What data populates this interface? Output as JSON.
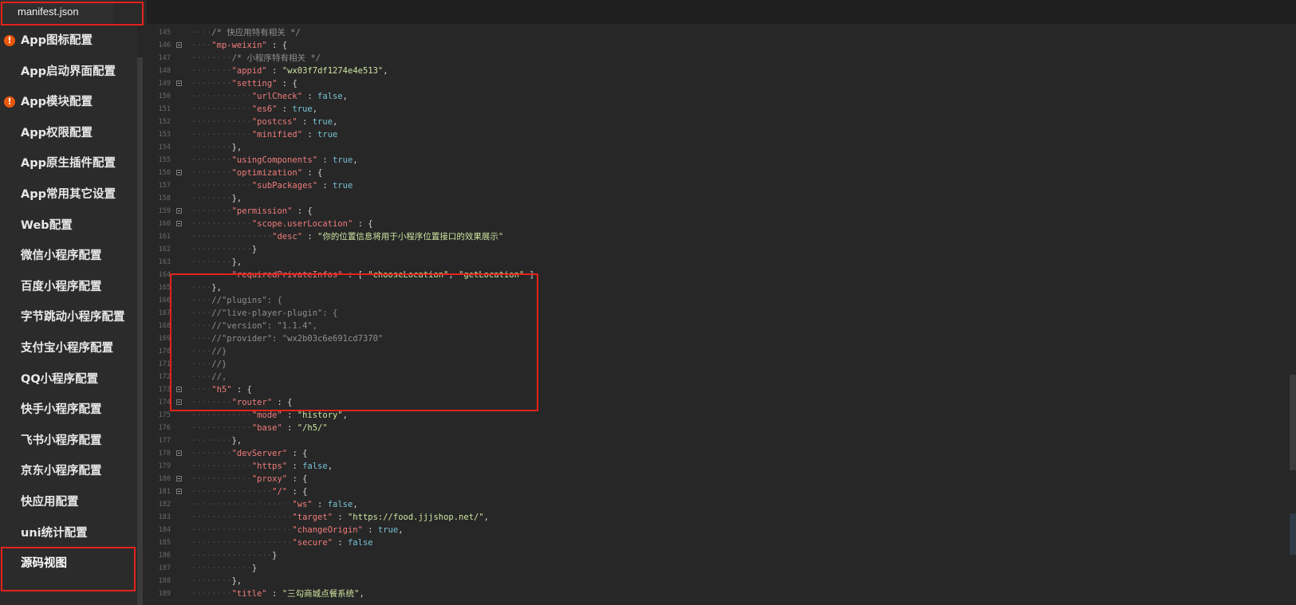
{
  "tab": {
    "title": "manifest.json"
  },
  "sidebar": {
    "items": [
      {
        "label": "App图标配置",
        "warning": true
      },
      {
        "label": "App启动界面配置",
        "warning": false
      },
      {
        "label": "App模块配置",
        "warning": true
      },
      {
        "label": "App权限配置",
        "warning": false
      },
      {
        "label": "App原生插件配置",
        "warning": false
      },
      {
        "label": "App常用其它设置",
        "warning": false
      },
      {
        "label": "Web配置",
        "warning": false
      },
      {
        "label": "微信小程序配置",
        "warning": false
      },
      {
        "label": "百度小程序配置",
        "warning": false
      },
      {
        "label": "字节跳动小程序配置",
        "warning": false
      },
      {
        "label": "支付宝小程序配置",
        "warning": false
      },
      {
        "label": "QQ小程序配置",
        "warning": false
      },
      {
        "label": "快手小程序配置",
        "warning": false
      },
      {
        "label": "飞书小程序配置",
        "warning": false
      },
      {
        "label": "京东小程序配置",
        "warning": false
      },
      {
        "label": "快应用配置",
        "warning": false
      },
      {
        "label": "uni统计配置",
        "warning": false
      },
      {
        "label": "源码视图",
        "warning": false,
        "active": true
      }
    ]
  },
  "editor": {
    "lines": [
      {
        "n": "145",
        "fold": false,
        "indent": 1,
        "tokens": [
          {
            "c": "cmt",
            "t": "/* 快应用特有相关 */"
          }
        ]
      },
      {
        "n": "146",
        "fold": true,
        "indent": 1,
        "tokens": [
          {
            "c": "key",
            "t": "\"mp-weixin\""
          },
          {
            "c": "punc",
            "t": " : {"
          }
        ]
      },
      {
        "n": "147",
        "fold": false,
        "indent": 2,
        "tokens": [
          {
            "c": "cmt",
            "t": "/* 小程序特有相关 */"
          }
        ]
      },
      {
        "n": "148",
        "fold": false,
        "indent": 2,
        "tokens": [
          {
            "c": "key",
            "t": "\"appid\""
          },
          {
            "c": "punc",
            "t": " : "
          },
          {
            "c": "str",
            "t": "\"wx03f7df1274e4e513\""
          },
          {
            "c": "punc",
            "t": ","
          }
        ]
      },
      {
        "n": "149",
        "fold": true,
        "indent": 2,
        "tokens": [
          {
            "c": "key",
            "t": "\"setting\""
          },
          {
            "c": "punc",
            "t": " : {"
          }
        ]
      },
      {
        "n": "150",
        "fold": false,
        "indent": 3,
        "tokens": [
          {
            "c": "key",
            "t": "\"urlCheck\""
          },
          {
            "c": "punc",
            "t": " : "
          },
          {
            "c": "bool",
            "t": "false"
          },
          {
            "c": "punc",
            "t": ","
          }
        ]
      },
      {
        "n": "151",
        "fold": false,
        "indent": 3,
        "tokens": [
          {
            "c": "key",
            "t": "\"es6\""
          },
          {
            "c": "punc",
            "t": " : "
          },
          {
            "c": "bool",
            "t": "true"
          },
          {
            "c": "punc",
            "t": ","
          }
        ]
      },
      {
        "n": "152",
        "fold": false,
        "indent": 3,
        "tokens": [
          {
            "c": "key",
            "t": "\"postcss\""
          },
          {
            "c": "punc",
            "t": " : "
          },
          {
            "c": "bool",
            "t": "true"
          },
          {
            "c": "punc",
            "t": ","
          }
        ]
      },
      {
        "n": "153",
        "fold": false,
        "indent": 3,
        "tokens": [
          {
            "c": "key",
            "t": "\"minified\""
          },
          {
            "c": "punc",
            "t": " : "
          },
          {
            "c": "bool",
            "t": "true"
          }
        ]
      },
      {
        "n": "154",
        "fold": false,
        "indent": 2,
        "tokens": [
          {
            "c": "punc",
            "t": "},"
          }
        ]
      },
      {
        "n": "155",
        "fold": false,
        "indent": 2,
        "tokens": [
          {
            "c": "key",
            "t": "\"usingComponents\""
          },
          {
            "c": "punc",
            "t": " : "
          },
          {
            "c": "bool",
            "t": "true"
          },
          {
            "c": "punc",
            "t": ","
          }
        ]
      },
      {
        "n": "156",
        "fold": true,
        "indent": 2,
        "tokens": [
          {
            "c": "key",
            "t": "\"optimization\""
          },
          {
            "c": "punc",
            "t": " : {"
          }
        ]
      },
      {
        "n": "157",
        "fold": false,
        "indent": 3,
        "tokens": [
          {
            "c": "key",
            "t": "\"subPackages\""
          },
          {
            "c": "punc",
            "t": " : "
          },
          {
            "c": "bool",
            "t": "true"
          }
        ]
      },
      {
        "n": "158",
        "fold": false,
        "indent": 2,
        "tokens": [
          {
            "c": "punc",
            "t": "},"
          }
        ]
      },
      {
        "n": "159",
        "fold": true,
        "indent": 2,
        "tokens": [
          {
            "c": "key",
            "t": "\"permission\""
          },
          {
            "c": "punc",
            "t": " : {"
          }
        ]
      },
      {
        "n": "160",
        "fold": true,
        "indent": 3,
        "tokens": [
          {
            "c": "key",
            "t": "\"scope.userLocation\""
          },
          {
            "c": "punc",
            "t": " : {"
          }
        ]
      },
      {
        "n": "161",
        "fold": false,
        "indent": 4,
        "tokens": [
          {
            "c": "key",
            "t": "\"desc\""
          },
          {
            "c": "punc",
            "t": " : "
          },
          {
            "c": "str",
            "t": "\"你的位置信息将用于小程序位置接口的效果展示\""
          }
        ]
      },
      {
        "n": "162",
        "fold": false,
        "indent": 3,
        "tokens": [
          {
            "c": "punc",
            "t": "}"
          }
        ]
      },
      {
        "n": "163",
        "fold": false,
        "indent": 2,
        "tokens": [
          {
            "c": "punc",
            "t": "},"
          }
        ]
      },
      {
        "n": "164",
        "fold": false,
        "indent": 2,
        "tokens": [
          {
            "c": "key",
            "t": "\"requiredPrivateInfos\""
          },
          {
            "c": "punc",
            "t": " : [ "
          },
          {
            "c": "str",
            "t": "\"chooseLocation\""
          },
          {
            "c": "punc",
            "t": ", "
          },
          {
            "c": "str",
            "t": "\"getLocation\""
          },
          {
            "c": "punc",
            "t": " ]"
          }
        ]
      },
      {
        "n": "165",
        "fold": false,
        "indent": 1,
        "tokens": [
          {
            "c": "punc",
            "t": "},"
          }
        ]
      },
      {
        "n": "166",
        "fold": false,
        "indent": 1,
        "tokens": [
          {
            "c": "cmt",
            "t": "//\"plugins\": {"
          }
        ]
      },
      {
        "n": "167",
        "fold": false,
        "indent": 1,
        "tokens": [
          {
            "c": "cmt",
            "t": "//\"live-player-plugin\": {"
          }
        ]
      },
      {
        "n": "168",
        "fold": false,
        "indent": 1,
        "tokens": [
          {
            "c": "cmt",
            "t": "//\"version\": \"1.1.4\","
          }
        ]
      },
      {
        "n": "169",
        "fold": false,
        "indent": 1,
        "tokens": [
          {
            "c": "cmt",
            "t": "//\"provider\": \"wx2b03c6e691cd7370\""
          }
        ]
      },
      {
        "n": "170",
        "fold": false,
        "indent": 1,
        "tokens": [
          {
            "c": "cmt",
            "t": "//}"
          }
        ]
      },
      {
        "n": "171",
        "fold": false,
        "indent": 1,
        "tokens": [
          {
            "c": "cmt",
            "t": "//}"
          }
        ]
      },
      {
        "n": "172",
        "fold": false,
        "indent": 1,
        "tokens": [
          {
            "c": "cmt",
            "t": "//,"
          }
        ]
      },
      {
        "n": "173",
        "fold": true,
        "indent": 1,
        "tokens": [
          {
            "c": "key",
            "t": "\"h5\""
          },
          {
            "c": "punc",
            "t": " : {"
          }
        ]
      },
      {
        "n": "174",
        "fold": true,
        "indent": 2,
        "tokens": [
          {
            "c": "key",
            "t": "\"router\""
          },
          {
            "c": "punc",
            "t": " : {"
          }
        ]
      },
      {
        "n": "175",
        "fold": false,
        "indent": 3,
        "tokens": [
          {
            "c": "key",
            "t": "\"mode\""
          },
          {
            "c": "punc",
            "t": " : "
          },
          {
            "c": "str",
            "t": "\"history\""
          },
          {
            "c": "punc",
            "t": ","
          }
        ]
      },
      {
        "n": "176",
        "fold": false,
        "indent": 3,
        "tokens": [
          {
            "c": "key",
            "t": "\"base\""
          },
          {
            "c": "punc",
            "t": " : "
          },
          {
            "c": "str",
            "t": "\"/h5/\""
          }
        ]
      },
      {
        "n": "177",
        "fold": false,
        "indent": 2,
        "tokens": [
          {
            "c": "punc",
            "t": "},"
          }
        ]
      },
      {
        "n": "178",
        "fold": true,
        "indent": 2,
        "tokens": [
          {
            "c": "key",
            "t": "\"devServer\""
          },
          {
            "c": "punc",
            "t": " : {"
          }
        ]
      },
      {
        "n": "179",
        "fold": false,
        "indent": 3,
        "tokens": [
          {
            "c": "key",
            "t": "\"https\""
          },
          {
            "c": "punc",
            "t": " : "
          },
          {
            "c": "bool",
            "t": "false"
          },
          {
            "c": "punc",
            "t": ","
          }
        ]
      },
      {
        "n": "180",
        "fold": true,
        "indent": 3,
        "tokens": [
          {
            "c": "key",
            "t": "\"proxy\""
          },
          {
            "c": "punc",
            "t": " : {"
          }
        ]
      },
      {
        "n": "181",
        "fold": true,
        "indent": 4,
        "tokens": [
          {
            "c": "key",
            "t": "\"/\""
          },
          {
            "c": "punc",
            "t": " : {"
          }
        ]
      },
      {
        "n": "182",
        "fold": false,
        "indent": 5,
        "tokens": [
          {
            "c": "key",
            "t": "\"ws\""
          },
          {
            "c": "punc",
            "t": " : "
          },
          {
            "c": "bool",
            "t": "false"
          },
          {
            "c": "punc",
            "t": ","
          }
        ]
      },
      {
        "n": "183",
        "fold": false,
        "indent": 5,
        "tokens": [
          {
            "c": "key",
            "t": "\"target\""
          },
          {
            "c": "punc",
            "t": " : "
          },
          {
            "c": "str",
            "t": "\"https://food.jjjshop.net/\""
          },
          {
            "c": "punc",
            "t": ","
          }
        ]
      },
      {
        "n": "184",
        "fold": false,
        "indent": 5,
        "tokens": [
          {
            "c": "key",
            "t": "\"changeOrigin\""
          },
          {
            "c": "punc",
            "t": " : "
          },
          {
            "c": "bool",
            "t": "true"
          },
          {
            "c": "punc",
            "t": ","
          }
        ]
      },
      {
        "n": "185",
        "fold": false,
        "indent": 5,
        "tokens": [
          {
            "c": "key",
            "t": "\"secure\""
          },
          {
            "c": "punc",
            "t": " : "
          },
          {
            "c": "bool",
            "t": "false"
          }
        ]
      },
      {
        "n": "186",
        "fold": false,
        "indent": 4,
        "tokens": [
          {
            "c": "punc",
            "t": "}"
          }
        ]
      },
      {
        "n": "187",
        "fold": false,
        "indent": 3,
        "tokens": [
          {
            "c": "punc",
            "t": "}"
          }
        ]
      },
      {
        "n": "188",
        "fold": false,
        "indent": 2,
        "tokens": [
          {
            "c": "punc",
            "t": "},"
          }
        ]
      },
      {
        "n": "189",
        "fold": false,
        "indent": 2,
        "tokens": [
          {
            "c": "key",
            "t": "\"title\""
          },
          {
            "c": "punc",
            "t": " : "
          },
          {
            "c": "str",
            "t": "\"三勾商城点餐系统\""
          },
          {
            "c": "punc",
            "t": ","
          }
        ]
      }
    ]
  },
  "colors": {
    "highlight_box": "#e3231b",
    "warning": "#e8580c",
    "key": "#f27c7c",
    "string": "#cfe3a1",
    "boolean": "#78c2d6",
    "comment": "#8f8f8f"
  }
}
